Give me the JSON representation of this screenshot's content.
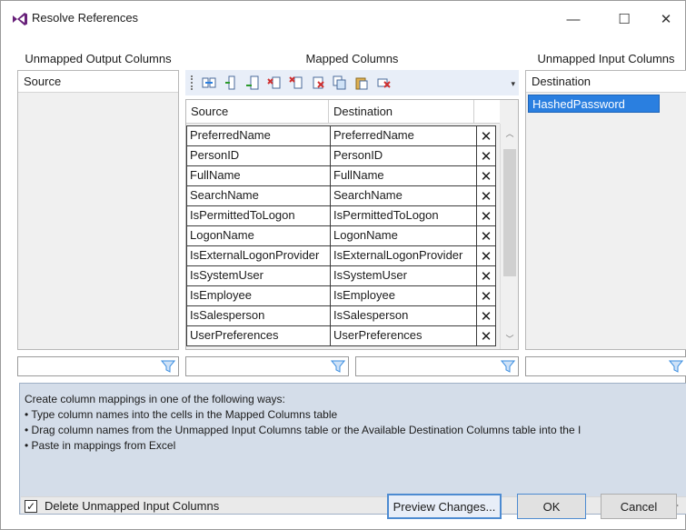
{
  "window": {
    "title": "Resolve References",
    "minimize_glyph": "—",
    "maximize_glyph": "☐",
    "close_glyph": "✕"
  },
  "unmapped_output": {
    "title": "Unmapped Output Columns",
    "header": "Source"
  },
  "mapped": {
    "title": "Mapped Columns",
    "columns": [
      "Source",
      "Destination"
    ],
    "delete_glyph": "✕",
    "rows": [
      {
        "source": "PreferredName",
        "destination": "PreferredName"
      },
      {
        "source": "PersonID",
        "destination": "PersonID"
      },
      {
        "source": "FullName",
        "destination": "FullName"
      },
      {
        "source": "SearchName",
        "destination": "SearchName"
      },
      {
        "source": "IsPermittedToLogon",
        "destination": "IsPermittedToLogon"
      },
      {
        "source": "LogonName",
        "destination": "LogonName"
      },
      {
        "source": "IsExternalLogonProvider",
        "destination": "IsExternalLogonProvider"
      },
      {
        "source": "IsSystemUser",
        "destination": "IsSystemUser"
      },
      {
        "source": "IsEmployee",
        "destination": "IsEmployee"
      },
      {
        "source": "IsSalesperson",
        "destination": "IsSalesperson"
      },
      {
        "source": "UserPreferences",
        "destination": "UserPreferences"
      }
    ],
    "toolbar_icons": [
      "map-icon",
      "insert-row-icon",
      "insert-row-below-icon",
      "delete-row-icon",
      "delete-selected-icon",
      "delete-all-icon",
      "copy-icon",
      "paste-icon",
      "clear-icon"
    ]
  },
  "unmapped_input": {
    "title": "Unmapped Input Columns",
    "header": "Destination",
    "items": [
      "HashedPassword"
    ]
  },
  "info": {
    "lines": [
      "Create column mappings in one of the following ways:",
      "• Type column names into the cells in the Mapped Columns table",
      "• Drag column names from the Unmapped Input Columns table or the Available Destination Columns table into the I",
      "• Paste in mappings from Excel"
    ]
  },
  "footer": {
    "checkbox_label": "Delete Unmapped Input Columns",
    "checkbox_checked": true,
    "check_glyph": "✓",
    "preview_label": "Preview Changes...",
    "ok_label": "OK",
    "cancel_label": "Cancel"
  },
  "colors": {
    "accent": "#2a7fe0",
    "info_bg": "#d4dde9",
    "filter_icon": "#3b8ee0",
    "toolbar_bg": "#e8eef8"
  }
}
